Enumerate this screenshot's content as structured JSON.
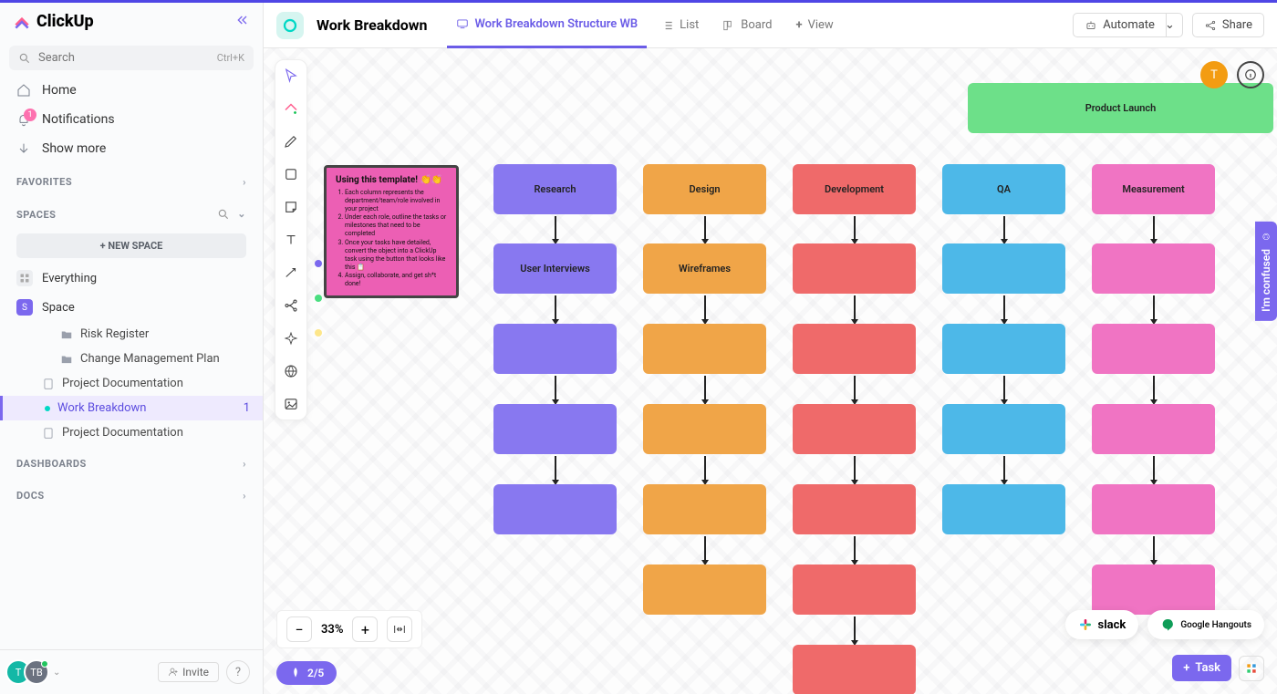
{
  "app": {
    "name": "ClickUp"
  },
  "search": {
    "placeholder": "Search",
    "shortcut": "Ctrl+K"
  },
  "nav": {
    "home": "Home",
    "notifications": "Notifications",
    "notif_count": "1",
    "show_more": "Show more"
  },
  "sections": {
    "favorites": "FAVORITES",
    "spaces": "SPACES",
    "dashboards": "DASHBOARDS",
    "docs": "DOCS"
  },
  "spaces": {
    "new_space": "+  NEW SPACE",
    "everything": "Everything",
    "space_initial": "S",
    "space_name": "Space",
    "risk": "Risk Register",
    "change": "Change Management Plan",
    "projdoc1": "Project Documentation",
    "wb": "Work Breakdown",
    "wb_count": "1",
    "projdoc2": "Project Documentation"
  },
  "footer": {
    "av1": "T",
    "av2": "TB",
    "invite": "Invite",
    "help": "?"
  },
  "header": {
    "title": "Work Breakdown",
    "tabs": {
      "whiteboard": "Work Breakdown Structure WB",
      "list": "List",
      "board": "Board",
      "add": "View"
    },
    "automate": "Automate",
    "share": "Share"
  },
  "zoom": {
    "level": "33%"
  },
  "tour": {
    "progress": "2/5"
  },
  "floating": {
    "avatar": "T"
  },
  "confused": "I'm confused",
  "integrations": {
    "slack": "slack",
    "hangouts": "Google Hangouts"
  },
  "task": {
    "label": "Task"
  },
  "board": {
    "root": "Product Launch",
    "sticky": {
      "title": "Using this template! 👏👏",
      "b1": "Each column represents the department/team/role involved in your project",
      "b2": "Under each role, outline the tasks or milestones that need to be completed",
      "b3": "Once your tasks have detailed, convert the object into a ClickUp task using the button that looks like this 📋",
      "b4": "Assign, collaborate, and get sh*t done!"
    },
    "columns": [
      {
        "color": "#8878f0",
        "label": "Research",
        "items": [
          "User Interviews",
          "",
          "",
          ""
        ]
      },
      {
        "color": "#f0a548",
        "label": "Design",
        "items": [
          "Wireframes",
          "",
          "",
          "",
          ""
        ]
      },
      {
        "color": "#ef6a6a",
        "label": "Development",
        "items": [
          "",
          "",
          "",
          "",
          "",
          ""
        ]
      },
      {
        "color": "#4db8e8",
        "label": "QA",
        "items": [
          "",
          "",
          "",
          ""
        ]
      },
      {
        "color": "#f074c3",
        "label": "Measurement",
        "items": [
          "",
          "",
          "",
          "",
          ""
        ]
      }
    ]
  }
}
